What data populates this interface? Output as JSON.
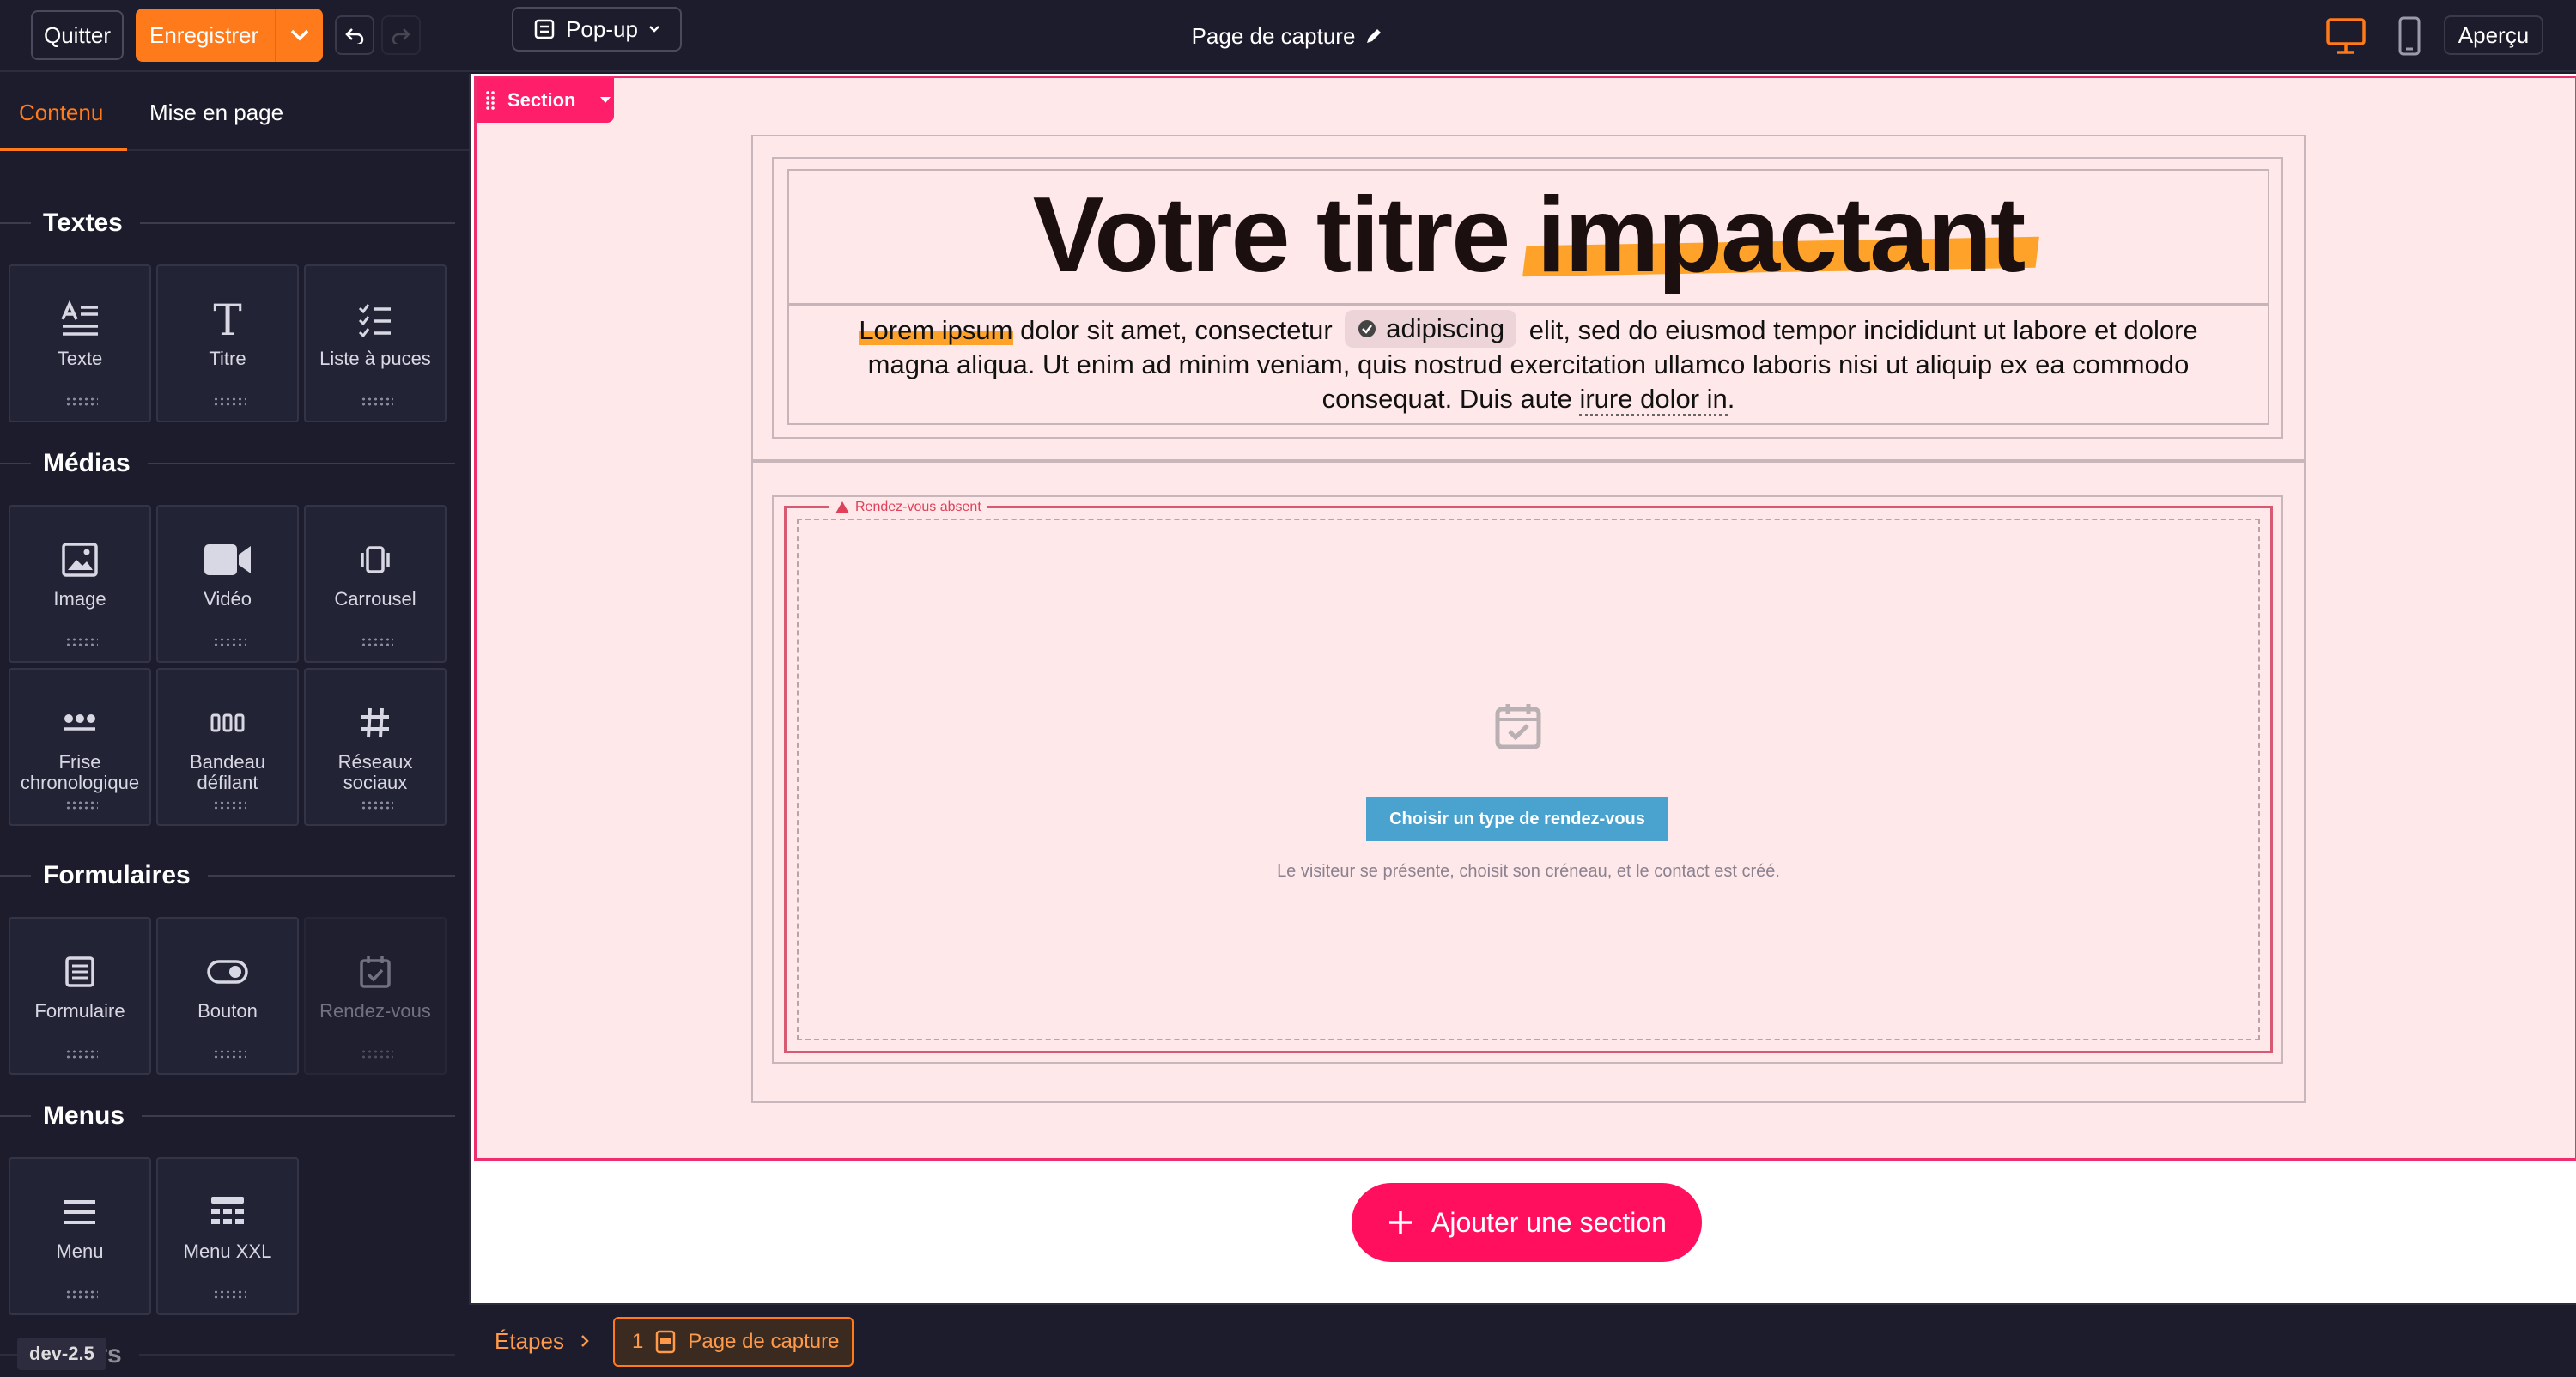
{
  "topbar": {
    "quit_label": "Quitter",
    "save_label": "Enregistrer",
    "popup_label": "Pop-up",
    "page_title": "Page de capture",
    "preview_label": "Aperçu"
  },
  "sidebar": {
    "tabs": [
      {
        "label": "Contenu",
        "active": true
      },
      {
        "label": "Mise en page",
        "active": false
      }
    ],
    "categories": {
      "textes": "Textes",
      "medias": "Médias",
      "formulaires": "Formulaires",
      "menus": "Menus",
      "divers": "Divers"
    },
    "tiles": {
      "texte": "Texte",
      "titre": "Titre",
      "liste": "Liste à puces",
      "image": "Image",
      "video": "Vidéo",
      "carrousel": "Carrousel",
      "frise": "Frise chronologique",
      "bandeau": "Bandeau défilant",
      "reseaux": "Réseaux sociaux",
      "formulaire": "Formulaire",
      "bouton": "Bouton",
      "rendezvous": "Rendez-vous",
      "menu": "Menu",
      "menuxxl": "Menu XXL"
    },
    "version": "dev-2.5"
  },
  "canvas": {
    "section_tag": "Section",
    "headline_part1": "Votre titre",
    "headline_part2": "impactant",
    "para": {
      "lorem": "Lorem ipsum",
      "p1": " dolor sit amet, consectetur ",
      "chip": "adipiscing",
      "p2": " elit, sed do eiusmod tempor incididunt ut labore et dolore magna aliqua. Ut enim ad minim veniam, quis nostrud exercitation ullamco laboris nisi ut aliquip ex ea commodo consequat. Duis aute ",
      "dotted": "irure dolor in",
      "p3": "."
    },
    "rdv": {
      "warning": "Rendez-vous absent",
      "cta": "Choisir un type de rendez-vous",
      "desc": "Le visiteur se présente, choisit son créneau, et le contact est créé."
    },
    "add_section_label": "Ajouter une section"
  },
  "bottombar": {
    "steps_label": "Étapes",
    "step_number": "1",
    "step_label": "Page de capture"
  },
  "colors": {
    "accent": "#ff7a1a",
    "section_border": "#ee2e6e",
    "add_button": "#ff0f5e",
    "highlight": "#ffa22a",
    "cta_blue": "#4aa2cf"
  }
}
